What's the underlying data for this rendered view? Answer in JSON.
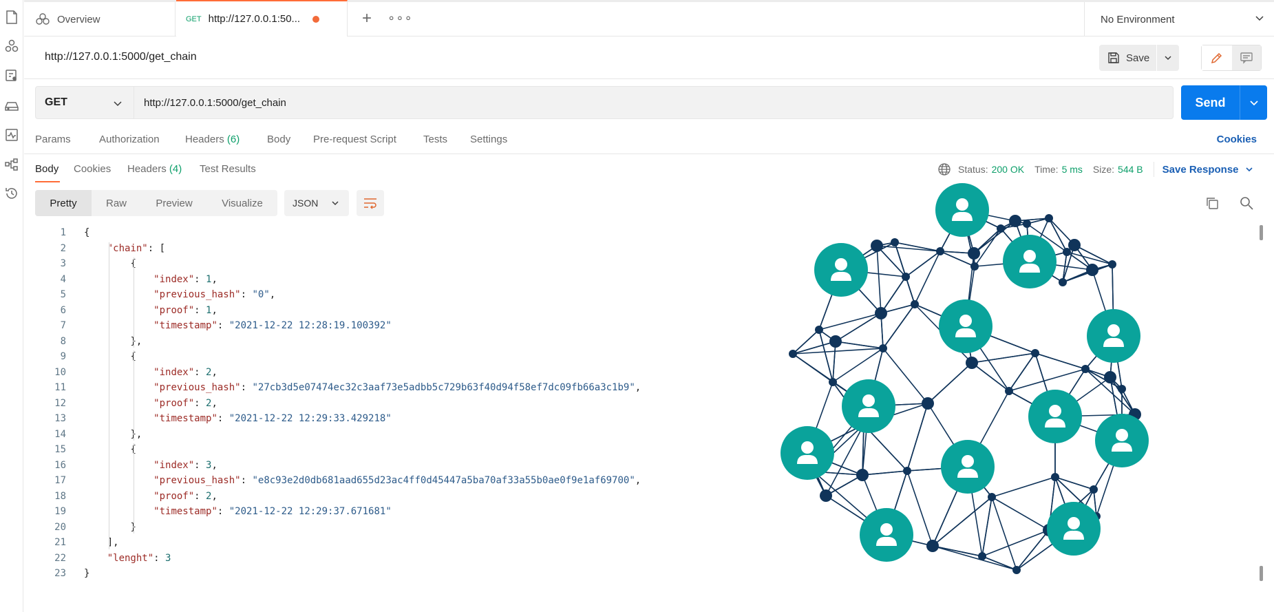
{
  "tabs": {
    "overview_label": "Overview",
    "active_method": "GET",
    "active_title": "http://127.0.0.1:50...",
    "plus": "+",
    "more": "∘∘∘"
  },
  "environment": {
    "label": "No Environment"
  },
  "request": {
    "title": "http://127.0.0.1:5000/get_chain",
    "save_label": "Save",
    "method": "GET",
    "url": "http://127.0.0.1:5000/get_chain",
    "send_label": "Send"
  },
  "request_tabs": {
    "params": "Params",
    "authorization": "Authorization",
    "headers": "Headers",
    "headers_count": "(6)",
    "body": "Body",
    "prerequest": "Pre-request Script",
    "tests": "Tests",
    "settings": "Settings",
    "cookies": "Cookies"
  },
  "response_tabs": {
    "body": "Body",
    "cookies": "Cookies",
    "headers": "Headers",
    "headers_count": "(4)",
    "test_results": "Test Results"
  },
  "response_status": {
    "status_label": "Status:",
    "status_value": "200 OK",
    "time_label": "Time:",
    "time_value": "5 ms",
    "size_label": "Size:",
    "size_value": "544 B",
    "save_response": "Save Response"
  },
  "view": {
    "pretty": "Pretty",
    "raw": "Raw",
    "preview": "Preview",
    "visualize": "Visualize",
    "format": "JSON"
  },
  "code_lines": [
    {
      "n": "1",
      "t": "{"
    },
    {
      "n": "2",
      "t": "    \"chain\": ["
    },
    {
      "n": "3",
      "t": "        {"
    },
    {
      "n": "4",
      "t": "            \"index\": 1,"
    },
    {
      "n": "5",
      "t": "            \"previous_hash\": \"0\","
    },
    {
      "n": "6",
      "t": "            \"proof\": 1,"
    },
    {
      "n": "7",
      "t": "            \"timestamp\": \"2021-12-22 12:28:19.100392\""
    },
    {
      "n": "8",
      "t": "        },"
    },
    {
      "n": "9",
      "t": "        {"
    },
    {
      "n": "10",
      "t": "            \"index\": 2,"
    },
    {
      "n": "11",
      "t": "            \"previous_hash\": \"27cb3d5e07474ec32c3aaf73e5adbb5c729b63f40d94f58ef7dc09fb66a3c1b9\","
    },
    {
      "n": "12",
      "t": "            \"proof\": 2,"
    },
    {
      "n": "13",
      "t": "            \"timestamp\": \"2021-12-22 12:29:33.429218\""
    },
    {
      "n": "14",
      "t": "        },"
    },
    {
      "n": "15",
      "t": "        {"
    },
    {
      "n": "16",
      "t": "            \"index\": 3,"
    },
    {
      "n": "17",
      "t": "            \"previous_hash\": \"e8c93e2d0db681aad655d23ac4ff0d45447a5ba70af33a55b0ae0f9e1af69700\","
    },
    {
      "n": "18",
      "t": "            \"proof\": 2,"
    },
    {
      "n": "19",
      "t": "            \"timestamp\": \"2021-12-22 12:29:37.671681\""
    },
    {
      "n": "20",
      "t": "        }"
    },
    {
      "n": "21",
      "t": "    ],"
    },
    {
      "n": "22",
      "t": "    \"lenght\": 3"
    },
    {
      "n": "23",
      "t": "}"
    }
  ],
  "colors": {
    "accent_orange": "#ff6c37",
    "send_blue": "#097bed",
    "status_green": "#0d9f6a",
    "link_blue": "#1a5fb4",
    "node_teal": "#0aa39b",
    "node_dark": "#10345a"
  },
  "icons": {
    "sidebar": [
      "collections-icon",
      "apis-icon",
      "environments-icon",
      "mock-servers-icon",
      "monitors-icon",
      "flows-icon",
      "history-icon"
    ]
  }
}
